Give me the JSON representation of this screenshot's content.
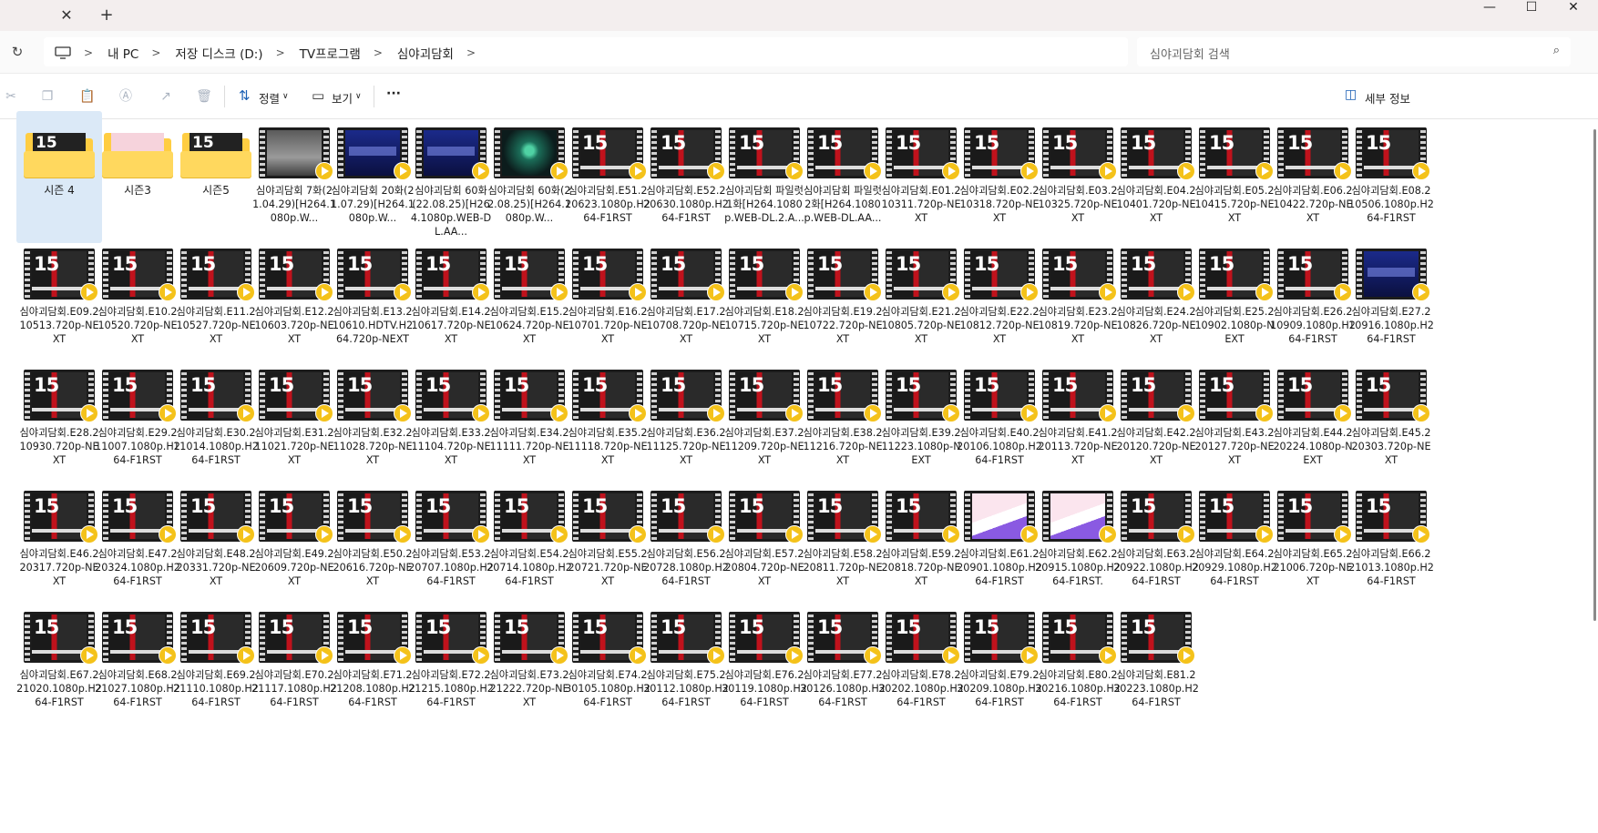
{
  "window": {
    "tab_close": "✕",
    "tab_new": "+",
    "minimize": "—",
    "maximize": "☐",
    "close": "✕"
  },
  "address": {
    "refresh_icon": "↻",
    "crumbs": [
      "내 PC",
      "저장 디스크 (D:)",
      "TV프로그램",
      "심야괴담회"
    ],
    "search_placeholder": "심야괴담회 검색",
    "search_icon": "⌕"
  },
  "toolbar": {
    "sort_label": "정렬",
    "view_label": "보기",
    "more_label": "···",
    "details_label": "세부 정보",
    "accent": "#1a5fb4"
  },
  "items": [
    {
      "type": "folder",
      "thumb": "red",
      "label": "시즌 4",
      "selected": true
    },
    {
      "type": "folder",
      "thumb": "pink",
      "label": "시즌3"
    },
    {
      "type": "folder",
      "thumb": "red",
      "label": "시즌5"
    },
    {
      "type": "video",
      "thumb": "gray",
      "label": "심야괴담회 7화(21.04.29)[H264.1080p.W..."
    },
    {
      "type": "video",
      "thumb": "blue",
      "label": "심야괴담회 20화(21.07.29)[H264.1080p.W..."
    },
    {
      "type": "video",
      "thumb": "blue",
      "label": "심야괴담회 60화 (22.08.25)[H264.1080p.WEB-DL.AA..."
    },
    {
      "type": "video",
      "thumb": "green",
      "label": "심야괴담회 60화(22.08.25)[H264.1080p.W..."
    },
    {
      "type": "video",
      "thumb": "red",
      "label": "심야괴담회.E51.220623.1080p.H264-F1RST"
    },
    {
      "type": "video",
      "thumb": "red",
      "label": "심야괴담회.E52.220630.1080p.H264-F1RST"
    },
    {
      "type": "video",
      "thumb": "red",
      "label": "심야괴담회 파일럿 1화[H264.1080p.WEB-DL.2.A..."
    },
    {
      "type": "video",
      "thumb": "red",
      "label": "심야괴담회 파일럿 2화[H264.1080p.WEB-DL.AA..."
    },
    {
      "type": "video",
      "thumb": "red",
      "label": "심야괴담회.E01.210311.720p-NEXT"
    },
    {
      "type": "video",
      "thumb": "red",
      "label": "심야괴담회.E02.210318.720p-NEXT"
    },
    {
      "type": "video",
      "thumb": "red",
      "label": "심야괴담회.E03.210325.720p-NEXT"
    },
    {
      "type": "video",
      "thumb": "red",
      "label": "심야괴담회.E04.210401.720p-NEXT"
    },
    {
      "type": "video",
      "thumb": "red",
      "label": "심야괴담회.E05.210415.720p-NEXT"
    },
    {
      "type": "video",
      "thumb": "red",
      "label": "심야괴담회.E06.210422.720p-NEXT"
    },
    {
      "type": "video",
      "thumb": "red",
      "label": "심야괴담회.E08.210506.1080p.H264-F1RST"
    },
    {
      "type": "video",
      "thumb": "red",
      "label": "심야괴담회.E09.210513.720p-NEXT"
    },
    {
      "type": "video",
      "thumb": "red",
      "label": "심야괴담회.E10.210520.720p-NEXT"
    },
    {
      "type": "video",
      "thumb": "red",
      "label": "심야괴담회.E11.210527.720p-NEXT"
    },
    {
      "type": "video",
      "thumb": "red",
      "label": "심야괴담회.E12.210603.720p-NEXT"
    },
    {
      "type": "video",
      "thumb": "red",
      "label": "심야괴담회.E13.210610.HDTV.H264.720p-NEXT"
    },
    {
      "type": "video",
      "thumb": "red",
      "label": "심야괴담회.E14.210617.720p-NEXT"
    },
    {
      "type": "video",
      "thumb": "red",
      "label": "심야괴담회.E15.210624.720p-NEXT"
    },
    {
      "type": "video",
      "thumb": "red",
      "label": "심야괴담회.E16.210701.720p-NEXT"
    },
    {
      "type": "video",
      "thumb": "red",
      "label": "심야괴담회.E17.210708.720p-NEXT"
    },
    {
      "type": "video",
      "thumb": "red",
      "label": "심야괴담회.E18.210715.720p-NEXT"
    },
    {
      "type": "video",
      "thumb": "red",
      "label": "심야괴담회.E19.210722.720p-NEXT"
    },
    {
      "type": "video",
      "thumb": "red",
      "label": "심야괴담회.E21.210805.720p-NEXT"
    },
    {
      "type": "video",
      "thumb": "red",
      "label": "심야괴담회.E22.210812.720p-NEXT"
    },
    {
      "type": "video",
      "thumb": "red",
      "label": "심야괴담회.E23.210819.720p-NEXT"
    },
    {
      "type": "video",
      "thumb": "red",
      "label": "심야괴담회.E24.210826.720p-NEXT"
    },
    {
      "type": "video",
      "thumb": "red",
      "label": "심야괴담회.E25.210902.1080p-NEXT"
    },
    {
      "type": "video",
      "thumb": "red",
      "label": "심야괴담회.E26.210909.1080p.H264-F1RST"
    },
    {
      "type": "video",
      "thumb": "blue",
      "label": "심야괴담회.E27.210916.1080p.H264-F1RST"
    },
    {
      "type": "video",
      "thumb": "red",
      "label": "심야괴담회.E28.210930.720p-NEXT"
    },
    {
      "type": "video",
      "thumb": "red",
      "label": "심야괴담회.E29.211007.1080p.H264-F1RST"
    },
    {
      "type": "video",
      "thumb": "red",
      "label": "심야괴담회.E30.211014.1080p.H264-F1RST"
    },
    {
      "type": "video",
      "thumb": "red",
      "label": "심야괴담회.E31.211021.720p-NEXT"
    },
    {
      "type": "video",
      "thumb": "red",
      "label": "심야괴담회.E32.211028.720p-NEXT"
    },
    {
      "type": "video",
      "thumb": "red",
      "label": "심야괴담회.E33.211104.720p-NEXT"
    },
    {
      "type": "video",
      "thumb": "red",
      "label": "심야괴담회.E34.211111.720p-NEXT"
    },
    {
      "type": "video",
      "thumb": "red",
      "label": "심야괴담회.E35.211118.720p-NEXT"
    },
    {
      "type": "video",
      "thumb": "red",
      "label": "심야괴담회.E36.211125.720p-NEXT"
    },
    {
      "type": "video",
      "thumb": "red",
      "label": "심야괴담회.E37.211209.720p-NEXT"
    },
    {
      "type": "video",
      "thumb": "red",
      "label": "심야괴담회.E38.211216.720p-NEXT"
    },
    {
      "type": "video",
      "thumb": "red",
      "label": "심야괴담회.E39.211223.1080p-NEXT"
    },
    {
      "type": "video",
      "thumb": "red",
      "label": "심야괴담회.E40.220106.1080p.H264-F1RST"
    },
    {
      "type": "video",
      "thumb": "red",
      "label": "심야괴담회.E41.220113.720p-NEXT"
    },
    {
      "type": "video",
      "thumb": "red",
      "label": "심야괴담회.E42.220120.720p-NEXT"
    },
    {
      "type": "video",
      "thumb": "red",
      "label": "심야괴담회.E43.220127.720p-NEXT"
    },
    {
      "type": "video",
      "thumb": "red",
      "label": "심야괴담회.E44.220224.1080p-NEXT"
    },
    {
      "type": "video",
      "thumb": "red",
      "label": "심야괴담회.E45.220303.720p-NEXT"
    },
    {
      "type": "video",
      "thumb": "red",
      "label": "심야괴담회.E46.220317.720p-NEXT"
    },
    {
      "type": "video",
      "thumb": "red",
      "label": "심야괴담회.E47.220324.1080p.H264-F1RST"
    },
    {
      "type": "video",
      "thumb": "red",
      "label": "심야괴담회.E48.220331.720p-NEXT"
    },
    {
      "type": "video",
      "thumb": "red",
      "label": "심야괴담회.E49.220609.720p-NEXT"
    },
    {
      "type": "video",
      "thumb": "red",
      "label": "심야괴담회.E50.220616.720p-NEXT"
    },
    {
      "type": "video",
      "thumb": "red",
      "label": "심야괴담회.E53.220707.1080p.H264-F1RST"
    },
    {
      "type": "video",
      "thumb": "red",
      "label": "심야괴담회.E54.220714.1080p.H264-F1RST"
    },
    {
      "type": "video",
      "thumb": "red",
      "label": "심야괴담회.E55.220721.720p-NEXT"
    },
    {
      "type": "video",
      "thumb": "red",
      "label": "심야괴담회.E56.220728.1080p.H264-F1RST"
    },
    {
      "type": "video",
      "thumb": "red",
      "label": "심야괴담회.E57.220804.720p-NEXT"
    },
    {
      "type": "video",
      "thumb": "red",
      "label": "심야괴담회.E58.220811.720p-NEXT"
    },
    {
      "type": "video",
      "thumb": "red",
      "label": "심야괴담회.E59.220818.720p-NEXT"
    },
    {
      "type": "video",
      "thumb": "pink",
      "label": "심야괴담회.E61.220901.1080p.H264-F1RST"
    },
    {
      "type": "video",
      "thumb": "pink",
      "label": "심야괴담회.E62.220915.1080p.H264-F1RST."
    },
    {
      "type": "video",
      "thumb": "red",
      "label": "심야괴담회.E63.220922.1080p.H264-F1RST"
    },
    {
      "type": "video",
      "thumb": "red",
      "label": "심야괴담회.E64.220929.1080p.H264-F1RST"
    },
    {
      "type": "video",
      "thumb": "red",
      "label": "심야괴담회.E65.221006.720p-NEXT"
    },
    {
      "type": "video",
      "thumb": "red",
      "label": "심야괴담회.E66.221013.1080p.H264-F1RST"
    },
    {
      "type": "video",
      "thumb": "red",
      "label": "심야괴담회.E67.221020.1080p.H264-F1RST"
    },
    {
      "type": "video",
      "thumb": "red",
      "label": "심야괴담회.E68.221027.1080p.H264-F1RST"
    },
    {
      "type": "video",
      "thumb": "red",
      "label": "심야괴담회.E69.221110.1080p.H264-F1RST"
    },
    {
      "type": "video",
      "thumb": "red",
      "label": "심야괴담회.E70.221117.1080p.H264-F1RST"
    },
    {
      "type": "video",
      "thumb": "red",
      "label": "심야괴담회.E71.221208.1080p.H264-F1RST"
    },
    {
      "type": "video",
      "thumb": "red",
      "label": "심야괴담회.E72.221215.1080p.H264-F1RST"
    },
    {
      "type": "video",
      "thumb": "red",
      "label": "심야괴담회.E73.221222.720p-NEXT"
    },
    {
      "type": "video",
      "thumb": "red",
      "label": "심야괴담회.E74.230105.1080p.H264-F1RST"
    },
    {
      "type": "video",
      "thumb": "red",
      "label": "심야괴담회.E75.230112.1080p.H264-F1RST"
    },
    {
      "type": "video",
      "thumb": "red",
      "label": "심야괴담회.E76.230119.1080p.H264-F1RST"
    },
    {
      "type": "video",
      "thumb": "red",
      "label": "심야괴담회.E77.230126.1080p.H264-F1RST"
    },
    {
      "type": "video",
      "thumb": "red",
      "label": "심야괴담회.E78.230202.1080p.H264-F1RST"
    },
    {
      "type": "video",
      "thumb": "red",
      "label": "심야괴담회.E79.230209.1080p.H264-F1RST"
    },
    {
      "type": "video",
      "thumb": "red",
      "label": "심야괴담회.E80.230216.1080p.H264-F1RST"
    },
    {
      "type": "video",
      "thumb": "red",
      "label": "심야괴담회.E81.230223.1080p.H264-F1RST"
    }
  ]
}
